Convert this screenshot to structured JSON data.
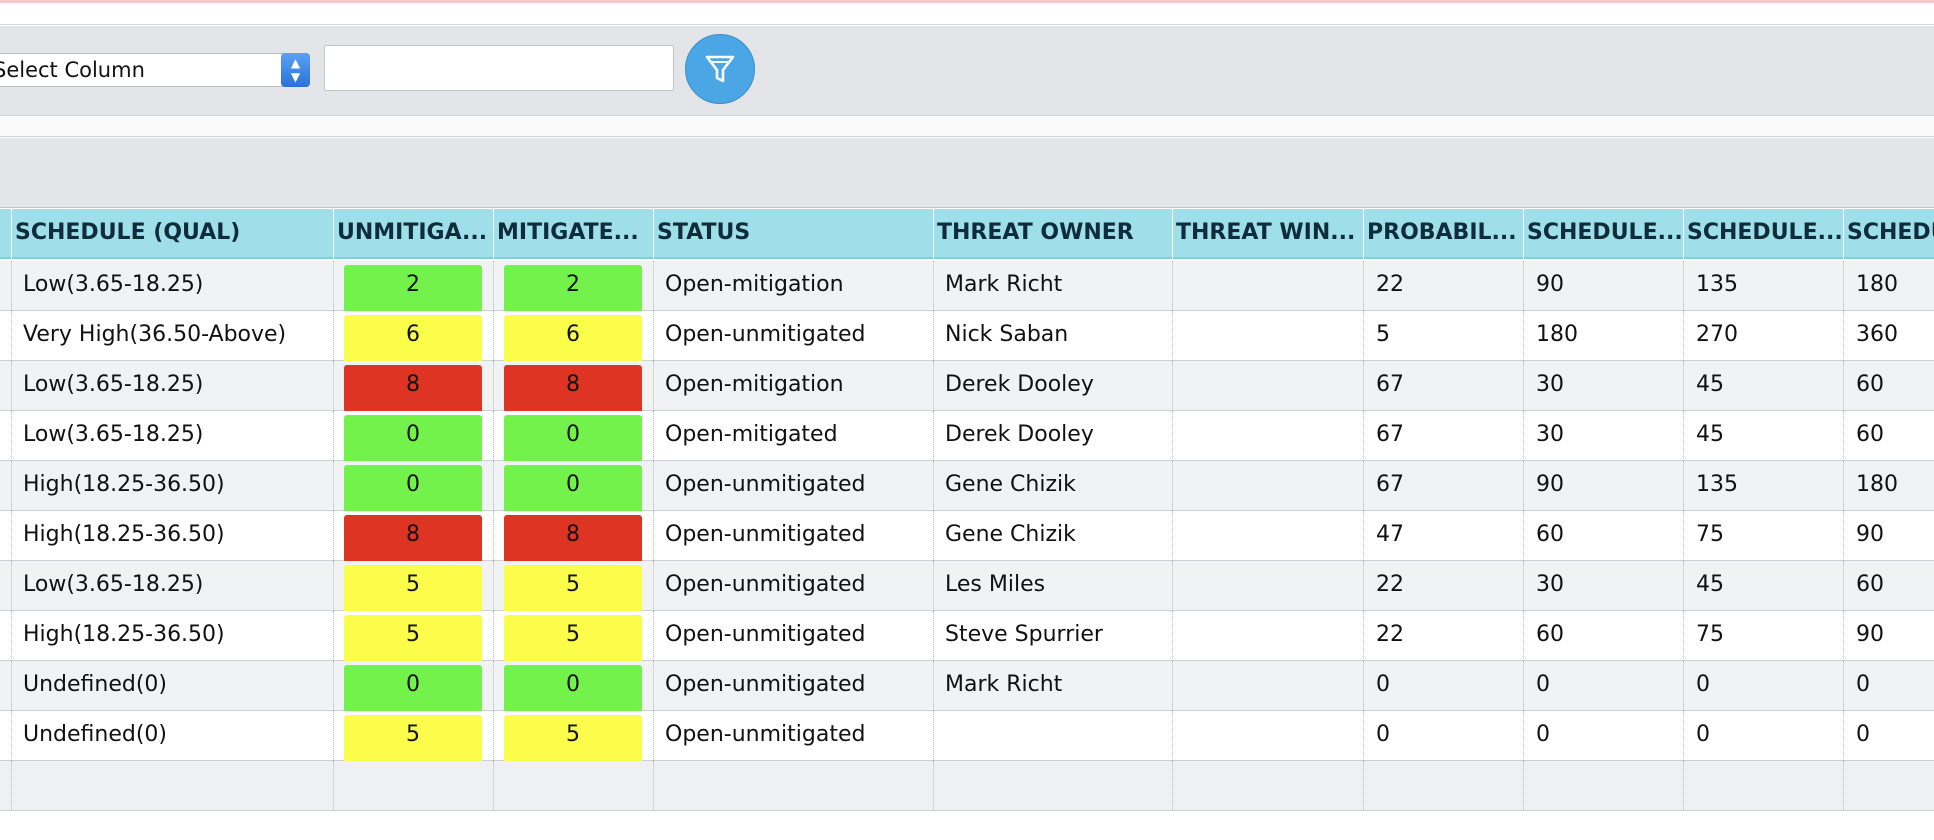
{
  "filter": {
    "column_select_value": "Select Column",
    "filter_input_value": "",
    "filter_button_icon": "filter-funnel-icon"
  },
  "table": {
    "headers": [
      "SCHEDULE (QUAL)",
      "UNMITIGA...",
      "MITIGATE...",
      "STATUS",
      "THREAT OWNER",
      "THREAT WIN...",
      "PROBABIL...",
      "SCHEDULE...",
      "SCHEDULE...",
      "SCHEDU"
    ],
    "rows": [
      {
        "schedule_qual": "Low(3.65-18.25)",
        "unmitigated": "2",
        "unmitigated_color": "green",
        "mitigated": "2",
        "mitigated_color": "green",
        "status": "Open-mitigation",
        "owner": "Mark Richt",
        "window": "",
        "probability": "22",
        "s1": "90",
        "s2": "135",
        "s3": "180"
      },
      {
        "schedule_qual": "Very High(36.50-Above)",
        "unmitigated": "6",
        "unmitigated_color": "yellow",
        "mitigated": "6",
        "mitigated_color": "yellow",
        "status": "Open-unmitigated",
        "owner": "Nick Saban",
        "window": "",
        "probability": "5",
        "s1": "180",
        "s2": "270",
        "s3": "360"
      },
      {
        "schedule_qual": "Low(3.65-18.25)",
        "unmitigated": "8",
        "unmitigated_color": "red",
        "mitigated": "8",
        "mitigated_color": "red",
        "status": "Open-mitigation",
        "owner": "Derek Dooley",
        "window": "",
        "probability": "67",
        "s1": "30",
        "s2": "45",
        "s3": "60"
      },
      {
        "schedule_qual": "Low(3.65-18.25)",
        "unmitigated": "0",
        "unmitigated_color": "green",
        "mitigated": "0",
        "mitigated_color": "green",
        "status": "Open-mitigated",
        "owner": "Derek Dooley",
        "window": "",
        "probability": "67",
        "s1": "30",
        "s2": "45",
        "s3": "60"
      },
      {
        "schedule_qual": "High(18.25-36.50)",
        "unmitigated": "0",
        "unmitigated_color": "green",
        "mitigated": "0",
        "mitigated_color": "green",
        "status": "Open-unmitigated",
        "owner": "Gene Chizik",
        "window": "",
        "probability": "67",
        "s1": "90",
        "s2": "135",
        "s3": "180"
      },
      {
        "schedule_qual": "High(18.25-36.50)",
        "unmitigated": "8",
        "unmitigated_color": "red",
        "mitigated": "8",
        "mitigated_color": "red",
        "status": "Open-unmitigated",
        "owner": "Gene Chizik",
        "window": "",
        "probability": "47",
        "s1": "60",
        "s2": "75",
        "s3": "90"
      },
      {
        "schedule_qual": "Low(3.65-18.25)",
        "unmitigated": "5",
        "unmitigated_color": "yellow",
        "mitigated": "5",
        "mitigated_color": "yellow",
        "status": "Open-unmitigated",
        "owner": "Les Miles",
        "window": "",
        "probability": "22",
        "s1": "30",
        "s2": "45",
        "s3": "60"
      },
      {
        "schedule_qual": "High(18.25-36.50)",
        "unmitigated": "5",
        "unmitigated_color": "yellow",
        "mitigated": "5",
        "mitigated_color": "yellow",
        "status": "Open-unmitigated",
        "owner": "Steve Spurrier",
        "window": "",
        "probability": "22",
        "s1": "60",
        "s2": "75",
        "s3": "90"
      },
      {
        "schedule_qual": "Undefined(0)",
        "unmitigated": "0",
        "unmitigated_color": "green",
        "mitigated": "0",
        "mitigated_color": "green",
        "status": "Open-unmitigated",
        "owner": "Mark Richt",
        "window": "",
        "probability": "0",
        "s1": "0",
        "s2": "0",
        "s3": "0"
      },
      {
        "schedule_qual": "Undefined(0)",
        "unmitigated": "5",
        "unmitigated_color": "yellow",
        "mitigated": "5",
        "mitigated_color": "yellow",
        "status": "Open-unmitigated",
        "owner": "",
        "window": "",
        "probability": "0",
        "s1": "0",
        "s2": "0",
        "s3": "0"
      }
    ]
  }
}
